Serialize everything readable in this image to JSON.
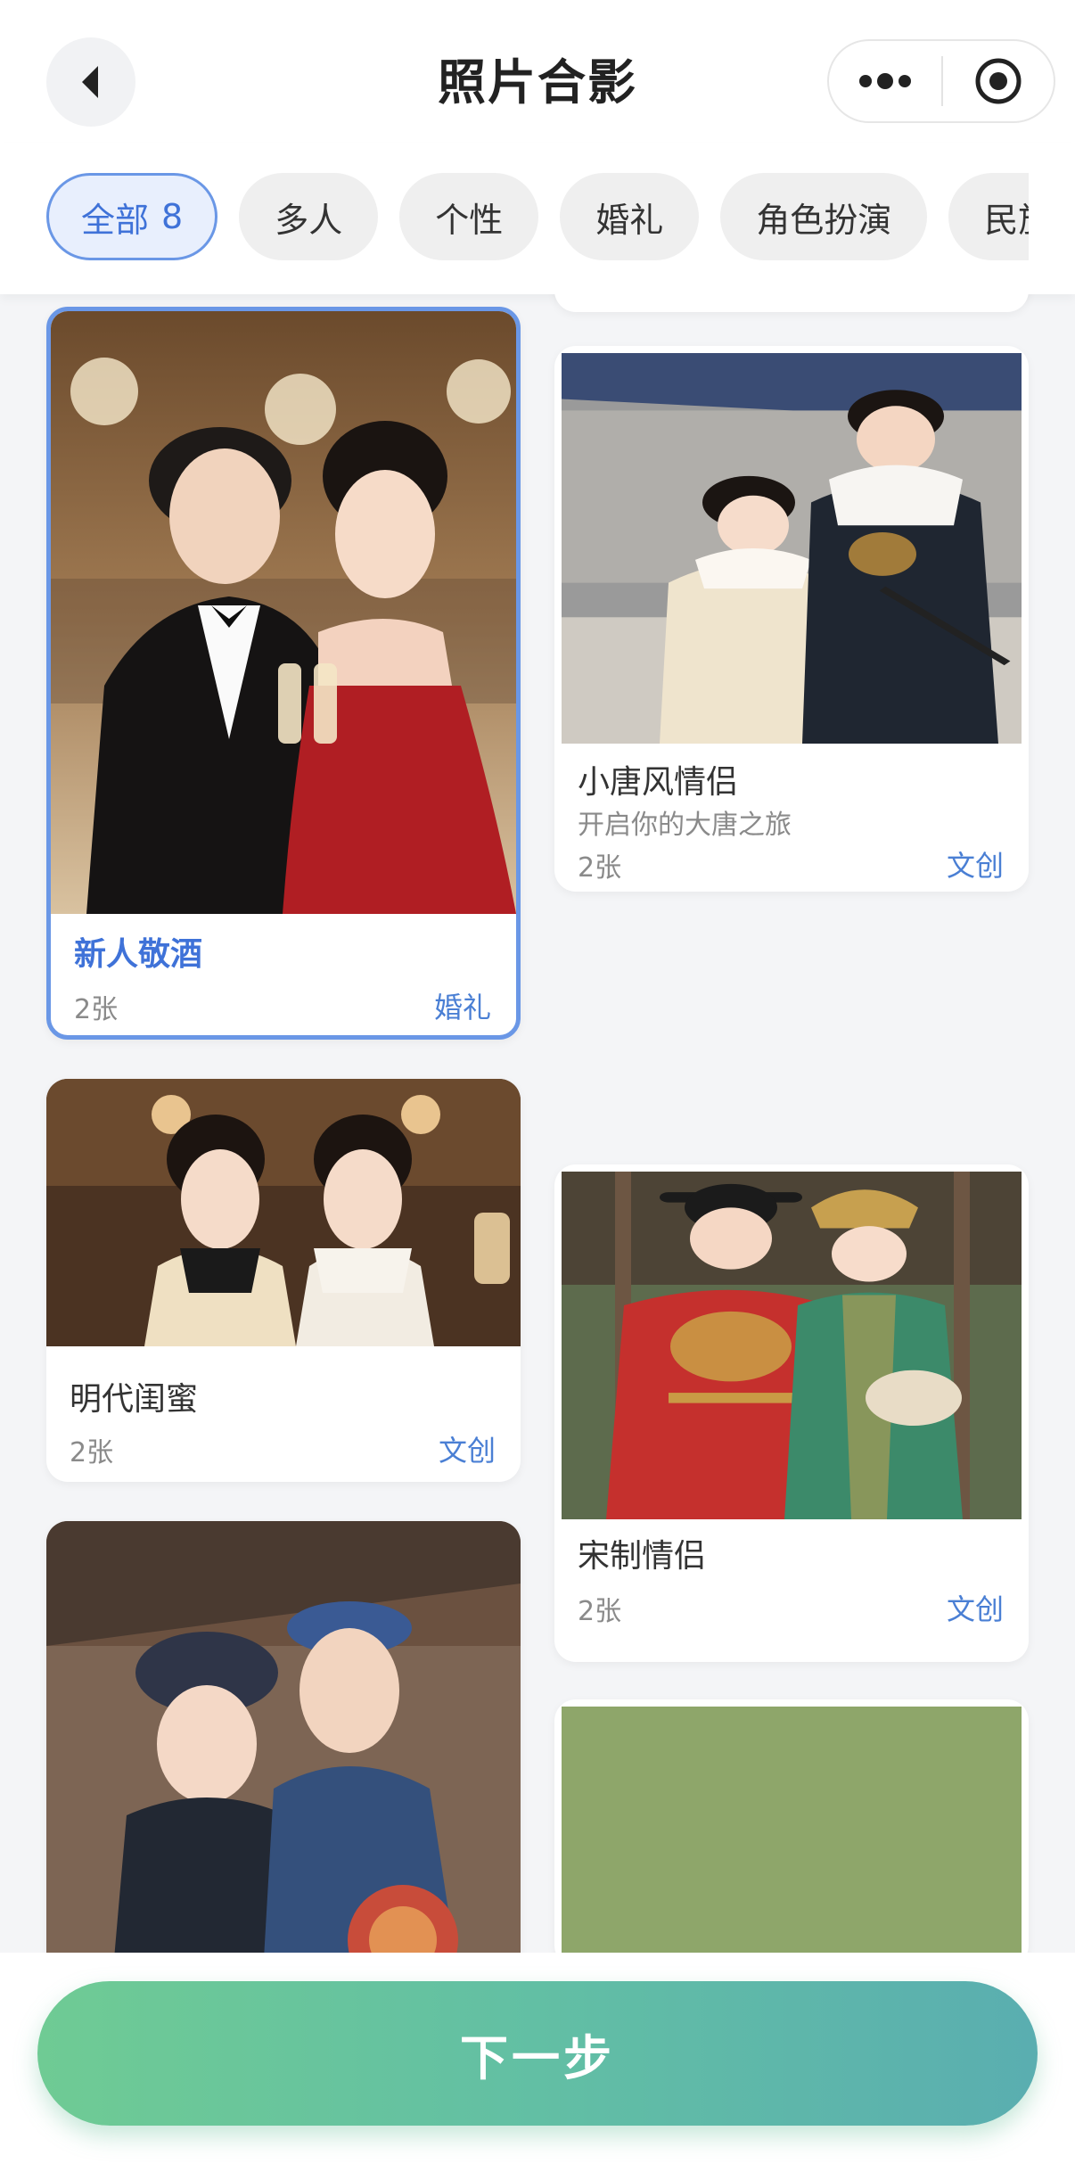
{
  "header": {
    "title": "照片合影"
  },
  "tabs": [
    {
      "label": "全部",
      "count": "8",
      "active": true
    },
    {
      "label": "多人"
    },
    {
      "label": "个性"
    },
    {
      "label": "婚礼"
    },
    {
      "label": "角色扮演"
    },
    {
      "label": "民族"
    }
  ],
  "cards": [
    {
      "name": "新人敬酒",
      "count": "2张",
      "tag": "婚礼",
      "selected": true
    },
    {
      "name": "明代闺蜜",
      "count": "2张",
      "tag": "文创"
    },
    {
      "name": "小唐风情侣",
      "subtitle": "开启你的大唐之旅",
      "count": "2张",
      "tag": "文创"
    },
    {
      "name": "宋制情侣",
      "count": "2张",
      "tag": "文创"
    }
  ],
  "footer": {
    "next_label": "下一步"
  },
  "colors": {
    "accent": "#3f72d8",
    "selected_border": "#6a97e6",
    "button_gradient_start": "#6fcb94",
    "button_gradient_end": "#5aaeb0"
  }
}
